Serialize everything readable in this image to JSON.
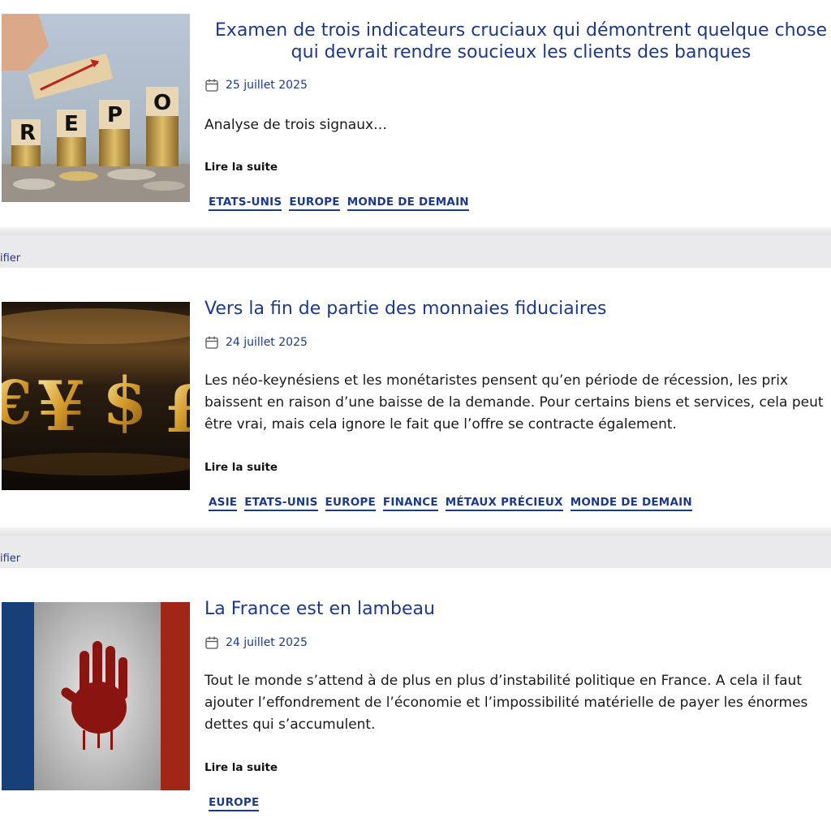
{
  "posts": [
    {
      "title": "Examen de trois indicateurs cruciaux qui démontrent quelque chose qui devrait rendre soucieux les clients des banques",
      "date": "25 juillet 2025",
      "excerpt": "Analyse de trois signaux…",
      "read_more": "Lire la suite",
      "tags": [
        "ETATS-UNIS",
        "EUROPE",
        "MONDE DE DEMAIN"
      ],
      "image": "repo-blocks-coins"
    },
    {
      "title": "Vers la fin de partie des monnaies fiduciaires",
      "date": "24 juillet 2025",
      "excerpt": "Les néo-keynésiens et les monétaristes pensent qu’en période de récession, les prix baissent en raison d’une baisse de la demande. Pour certains biens et services, cela peut être vrai, mais cela ignore le fait que l’offre se contracte également.",
      "read_more": "Lire la suite",
      "tags": [
        "ASIE",
        "ETATS-UNIS",
        "EUROPE",
        "FINANCE",
        "MÉTAUX PRÉCIEUX",
        "MONDE DE DEMAIN"
      ],
      "image": "gold-currency-symbols"
    },
    {
      "title": "La France est en lambeau",
      "date": "24 juillet 2025",
      "excerpt": "Tout le monde s’attend à de plus en plus d’instabilité politique en France. A cela il faut ajouter l’effondrement de l’économie et l’impossibilité matérielle de payer les énormes dettes qui s’accumulent.",
      "read_more": "Lire la suite",
      "tags": [
        "EUROPE"
      ],
      "image": "french-flag-bloody-hand"
    }
  ],
  "separator_text": "ifier",
  "colors": {
    "accent": "#1d3a8a",
    "separator": "#eaeaec"
  }
}
